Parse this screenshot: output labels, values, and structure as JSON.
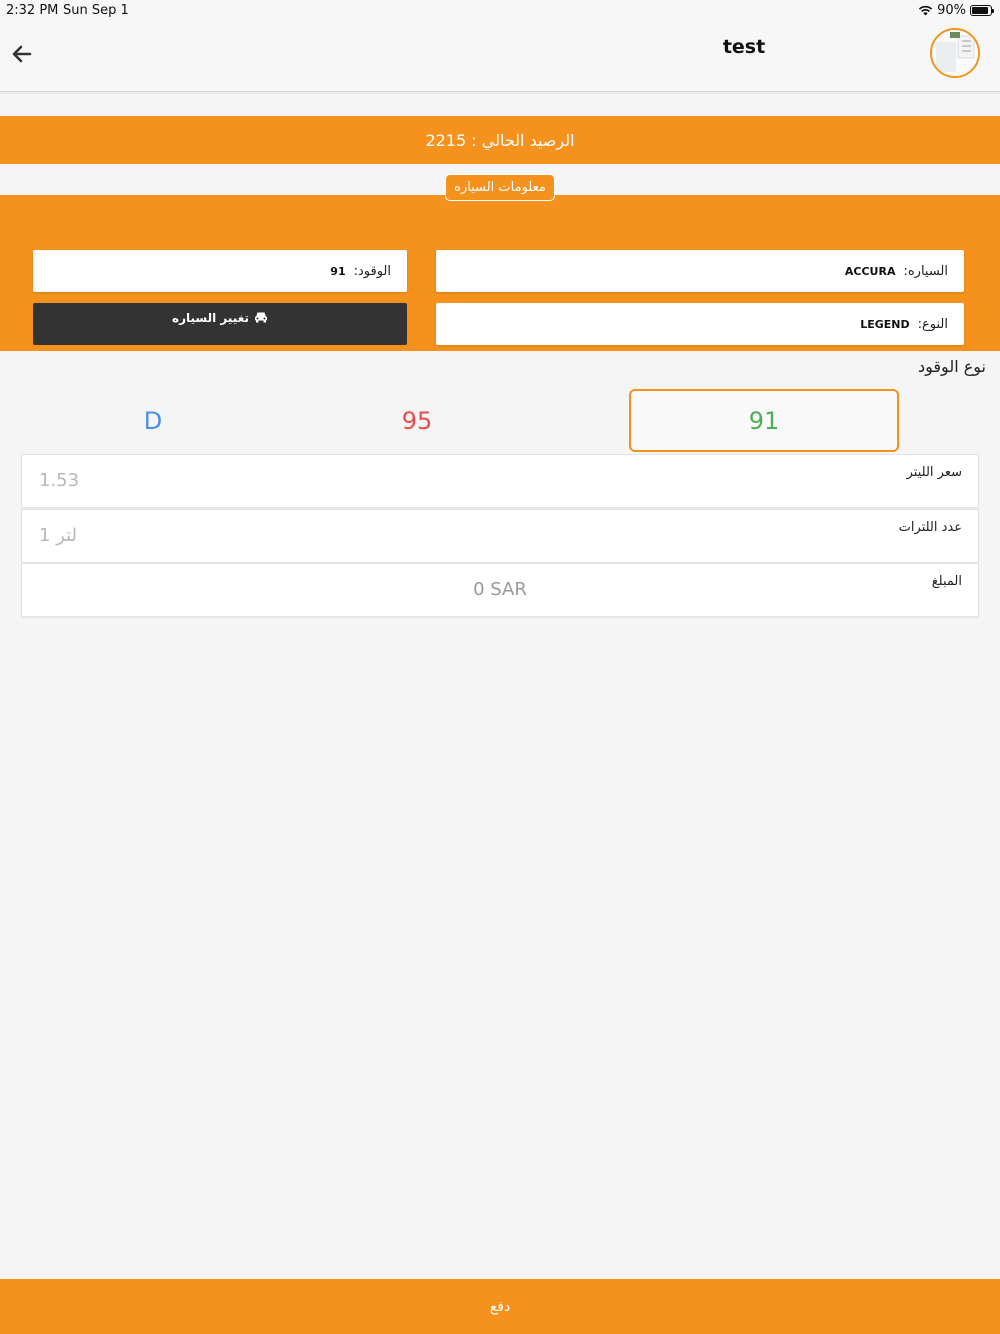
{
  "status_bar": {
    "time": "2:32 PM",
    "date": "Sun Sep 1",
    "battery": "90%",
    "battery_level": 0.9
  },
  "header": {
    "title": "test",
    "back_icon": "arrow-left-icon",
    "avatar": "user-avatar"
  },
  "balance": {
    "text": "الرصيد الحالي : 2215"
  },
  "car_info": {
    "tab_label": "معلومات السياره",
    "car_label": "السياره:",
    "car_value": "ACCURA",
    "fuel_label": "الوقود:",
    "fuel_value": "91",
    "type_label": "النوع:",
    "type_value": "LEGEND",
    "change_button": "تغيير السياره",
    "change_icon": "car-icon"
  },
  "fuel_selector": {
    "label": "نوع الوقود",
    "options": [
      {
        "label": "91",
        "color": "#4caf50",
        "selected": true
      },
      {
        "label": "95",
        "color": "#e84d4d",
        "selected": false
      },
      {
        "label": "D",
        "color": "#4a8ee8",
        "selected": false
      }
    ]
  },
  "form": {
    "price_label": "سعر الليتر",
    "price_value": "1.53",
    "liters_label": "عدد اللترات",
    "liters_placeholder": "لتر 1",
    "amount_label": "المبلغ",
    "amount_value": "0 SAR"
  },
  "pay_button": {
    "label": "دفع"
  },
  "colors": {
    "accent": "#f5921e",
    "dark_button": "#333333"
  }
}
